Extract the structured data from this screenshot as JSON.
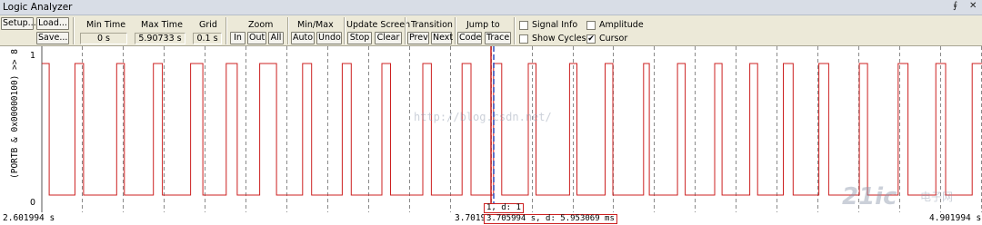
{
  "window": {
    "title": "Logic Analyzer"
  },
  "toolbar": {
    "setup_label": "Setup...",
    "load_label": "Load...",
    "save_label": "Save...",
    "min_time": {
      "label": "Min Time",
      "value": "0 s"
    },
    "max_time": {
      "label": "Max Time",
      "value": "5.90733 s"
    },
    "grid": {
      "label": "Grid",
      "value": "0.1 s"
    },
    "zoom": {
      "label": "Zoom",
      "in": "In",
      "out": "Out",
      "all": "All"
    },
    "minmax": {
      "label": "Min/Max",
      "auto": "Auto",
      "undo": "Undo"
    },
    "update_screen": {
      "label": "Update Screen",
      "stop": "Stop",
      "clear": "Clear"
    },
    "transition": {
      "label": "Transition",
      "prev": "Prev",
      "next": "Next"
    },
    "jump_to": {
      "label": "Jump to",
      "code": "Code",
      "trace": "Trace"
    },
    "signal_info": {
      "label": "Signal Info",
      "checked": false
    },
    "show_cycles": {
      "label": "Show Cycles",
      "checked": false
    },
    "amplitude": {
      "label": "Amplitude",
      "checked": false
    },
    "cursor": {
      "label": "Cursor",
      "checked": true
    }
  },
  "signal": {
    "name": "(PORTB & 0x00000100) >> 8",
    "y_high_label": "1",
    "y_low_label": "0",
    "line_color": "#cc2020"
  },
  "x_axis": {
    "left_label": "2.601994 s",
    "cursor_label": "3.70199",
    "right_label": "4.901994 s"
  },
  "cursor": {
    "value_box": "1,   d: 1",
    "time_box": "3.705994 s,   d: 5.953069 ms"
  },
  "watermark": {
    "text": "http://blog.csdn.net/",
    "brand": "21ic",
    "brand_sub": "电子网"
  },
  "chart_data": {
    "type": "line",
    "x_range": [
      2.601994,
      4.901994
    ],
    "y_range": [
      0,
      1
    ],
    "grid_step_s": 0.1,
    "cursor_time_s": 3.705994,
    "waveform_transitions_s": [
      2.601994,
      2.62,
      2.683,
      2.704,
      2.785,
      2.804,
      2.875,
      2.897,
      2.966,
      2.996,
      3.053,
      3.08,
      3.135,
      3.176,
      3.24,
      3.262,
      3.337,
      3.359,
      3.434,
      3.455,
      3.534,
      3.555,
      3.63,
      3.652,
      3.707,
      3.727,
      3.792,
      3.811,
      3.893,
      3.911,
      3.98,
      3.999,
      4.074,
      4.088,
      4.157,
      4.176,
      4.248,
      4.266,
      4.334,
      4.353,
      4.416,
      4.44,
      4.503,
      4.527,
      4.602,
      4.622,
      4.697,
      4.721,
      4.789,
      4.813,
      4.878,
      4.901994
    ],
    "initial_level": 1
  }
}
